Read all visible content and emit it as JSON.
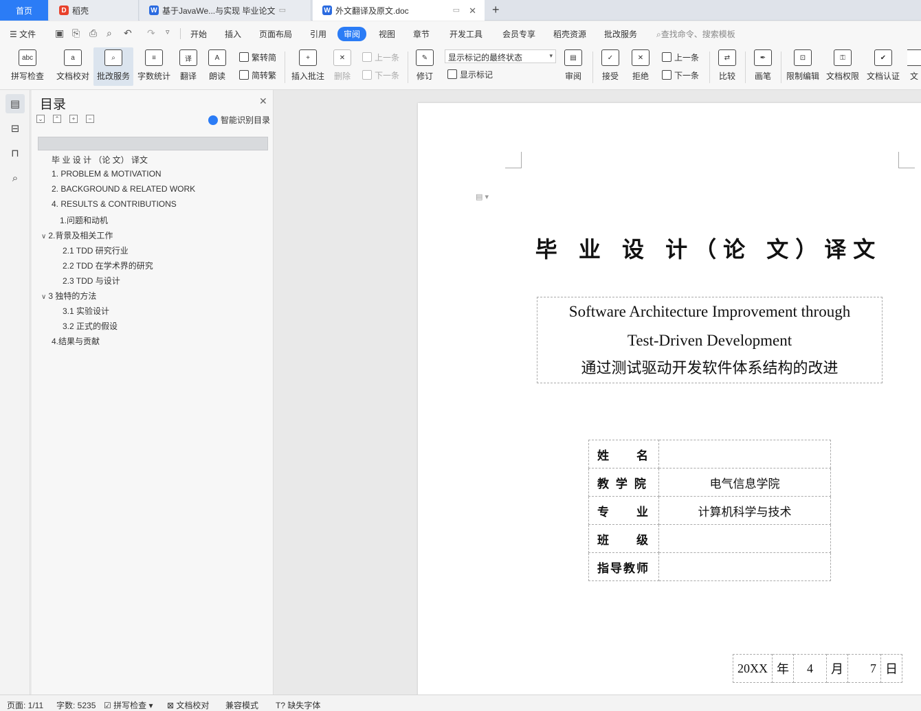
{
  "tabs": {
    "home": "首页",
    "t1": "稻壳",
    "t2": "基于JavaWe...与实现 毕业论文",
    "t3": "外文翻译及原文.doc"
  },
  "menu": {
    "file": "文件",
    "items": [
      "开始",
      "插入",
      "页面布局",
      "引用",
      "审阅",
      "视图",
      "章节",
      "开发工具",
      "会员专享",
      "稻壳资源",
      "批改服务"
    ],
    "active": "审阅",
    "search": "查找命令、搜索模板"
  },
  "ribbon": {
    "spell": "拼写检查",
    "proof": "文档校对",
    "correct": "批改服务",
    "wordcount": "字数统计",
    "translate": "翻译",
    "read": "朗读",
    "trad2simp": "繁转简",
    "simp2trad": "简转繁",
    "insert_comment": "插入批注",
    "delete": "删除",
    "prev": "上一条",
    "next": "下一条",
    "revise": "修订",
    "markup_state": "显示标记的最终状态",
    "show_markup": "显示标记",
    "review": "审阅",
    "accept": "接受",
    "reject": "拒绝",
    "prev2": "上一条",
    "next2": "下一条",
    "compare": "比较",
    "ink": "画笔",
    "restrict": "限制编辑",
    "permission": "文档权限",
    "certify": "文档认证",
    "cut": "文"
  },
  "toc": {
    "title": "目录",
    "smart": "智能识别目录",
    "items": [
      "毕 业 设 计 （论 文） 译文",
      "1. PROBLEM & MOTIVATION",
      "2. BACKGROUND & RELATED WORK",
      "4. RESULTS & CONTRIBUTIONS",
      "1.问题和动机",
      "2.背景及相关工作",
      "2.1 TDD 研究行业",
      "2.2 TDD 在学术界的研究",
      "2.3 TDD 与设计",
      "3  独特的方法",
      "3.1 实验设计",
      "3.2 正式的假设",
      "4.结果与贡献"
    ]
  },
  "doc": {
    "title": "毕 业 设 计（论 文）译文",
    "en1": "Software Architecture Improvement through",
    "en2": "Test-Driven Development",
    "zh": "通过测试驱动开发软件体系结构的改进",
    "rows": [
      {
        "k": "姓　　名",
        "v": ""
      },
      {
        "k": "教 学 院",
        "v": "电气信息学院"
      },
      {
        "k": "专　　业",
        "v": "计算机科学与技术"
      },
      {
        "k": "班　　级",
        "v": ""
      },
      {
        "k": "指导教师",
        "v": ""
      }
    ],
    "date": {
      "year": "20XX",
      "y": "年",
      "month": "4",
      "m": "月",
      "day": "7",
      "d": "日"
    }
  },
  "status": {
    "page": "页面: 1/11",
    "words": "字数: 5235",
    "spell": "拼写检查",
    "proof": "文档校对",
    "compat": "兼容模式",
    "font": "缺失字体"
  }
}
